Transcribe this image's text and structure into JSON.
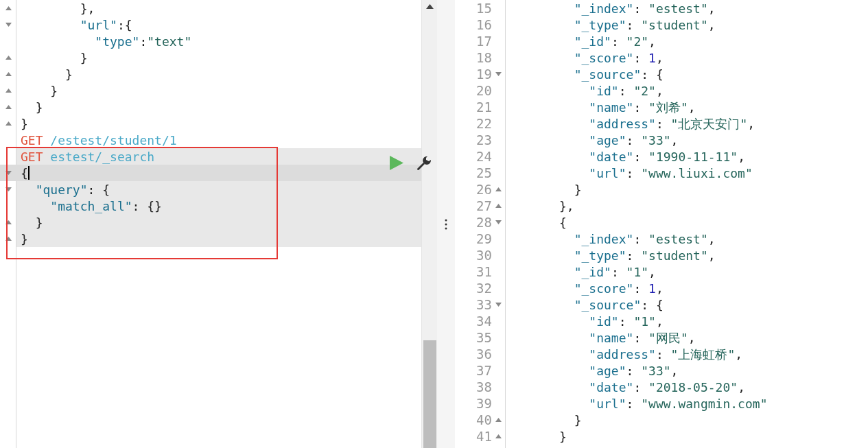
{
  "request_editor": {
    "lines": [
      {
        "kind": "close",
        "tokens": [
          {
            "kind": "punct",
            "text": "},"
          }
        ],
        "highlighted": false,
        "active": false
      },
      {
        "kind": "open",
        "tokens": [
          {
            "kind": "key",
            "text": "\"url\""
          },
          {
            "kind": "punct",
            "text": ":{"
          }
        ],
        "highlighted": false,
        "active": false
      },
      {
        "kind": "plain",
        "tokens": [
          {
            "kind": "key",
            "text": "\"type\""
          },
          {
            "kind": "punct",
            "text": ":"
          },
          {
            "kind": "str",
            "text": "\"text\""
          }
        ],
        "highlighted": false,
        "active": false
      },
      {
        "kind": "close",
        "tokens": [
          {
            "kind": "punct",
            "text": "}"
          }
        ],
        "highlighted": false,
        "active": false
      },
      {
        "kind": "close",
        "tokens": [
          {
            "kind": "punct",
            "text": "}"
          }
        ],
        "highlighted": false,
        "active": false
      },
      {
        "kind": "close",
        "tokens": [
          {
            "kind": "punct",
            "text": "}"
          }
        ],
        "highlighted": false,
        "active": false
      },
      {
        "kind": "close",
        "tokens": [
          {
            "kind": "punct",
            "text": "}"
          }
        ],
        "highlighted": false,
        "active": false
      },
      {
        "kind": "close",
        "tokens": [
          {
            "kind": "punct",
            "text": "}"
          }
        ],
        "highlighted": false,
        "active": false
      },
      {
        "kind": "plain",
        "tokens": [
          {
            "kind": "method",
            "text": "GET"
          },
          {
            "kind": "path",
            "text": "/estest/student/1"
          }
        ],
        "highlighted": false,
        "active": false
      },
      {
        "kind": "plain",
        "tokens": [
          {
            "kind": "method",
            "text": "GET"
          },
          {
            "kind": "path",
            "text": "estest/_search"
          }
        ],
        "highlighted": true,
        "active": false
      },
      {
        "kind": "open",
        "tokens": [
          {
            "kind": "punct",
            "text": "{"
          }
        ],
        "highlighted": true,
        "active": true
      },
      {
        "kind": "open",
        "tokens": [
          {
            "kind": "key",
            "text": "\"query\""
          },
          {
            "kind": "punct",
            "text": ": {"
          }
        ],
        "highlighted": true,
        "active": false
      },
      {
        "kind": "plain",
        "tokens": [
          {
            "kind": "key",
            "text": "\"match_all\""
          },
          {
            "kind": "punct",
            "text": ": {}"
          }
        ],
        "highlighted": true,
        "active": false
      },
      {
        "kind": "close",
        "tokens": [
          {
            "kind": "punct",
            "text": "}"
          }
        ],
        "highlighted": true,
        "active": false
      },
      {
        "kind": "close",
        "tokens": [
          {
            "kind": "punct",
            "text": "}"
          }
        ],
        "highlighted": true,
        "active": false
      }
    ]
  },
  "response_viewer": {
    "lines": [
      {
        "number": "15",
        "kind": "plain",
        "tokens": [
          {
            "kind": "key",
            "text": "\"_index\""
          },
          {
            "kind": "punct",
            "text": ": "
          },
          {
            "kind": "str",
            "text": "\"estest\""
          },
          {
            "kind": "punct",
            "text": ","
          }
        ]
      },
      {
        "number": "16",
        "kind": "plain",
        "tokens": [
          {
            "kind": "key",
            "text": "\"_type\""
          },
          {
            "kind": "punct",
            "text": ": "
          },
          {
            "kind": "str",
            "text": "\"student\""
          },
          {
            "kind": "punct",
            "text": ","
          }
        ]
      },
      {
        "number": "17",
        "kind": "plain",
        "tokens": [
          {
            "kind": "key",
            "text": "\"_id\""
          },
          {
            "kind": "punct",
            "text": ": "
          },
          {
            "kind": "str",
            "text": "\"2\""
          },
          {
            "kind": "punct",
            "text": ","
          }
        ]
      },
      {
        "number": "18",
        "kind": "plain",
        "tokens": [
          {
            "kind": "key",
            "text": "\"_score\""
          },
          {
            "kind": "punct",
            "text": ": "
          },
          {
            "kind": "num",
            "text": "1"
          },
          {
            "kind": "punct",
            "text": ","
          }
        ]
      },
      {
        "number": "19",
        "kind": "open",
        "tokens": [
          {
            "kind": "key",
            "text": "\"_source\""
          },
          {
            "kind": "punct",
            "text": ": {"
          }
        ]
      },
      {
        "number": "20",
        "kind": "plain",
        "tokens": [
          {
            "kind": "key",
            "text": "\"id\""
          },
          {
            "kind": "punct",
            "text": ": "
          },
          {
            "kind": "str",
            "text": "\"2\""
          },
          {
            "kind": "punct",
            "text": ","
          }
        ]
      },
      {
        "number": "21",
        "kind": "plain",
        "tokens": [
          {
            "kind": "key",
            "text": "\"name\""
          },
          {
            "kind": "punct",
            "text": ": "
          },
          {
            "kind": "str",
            "text": "\"刘希\""
          },
          {
            "kind": "punct",
            "text": ","
          }
        ]
      },
      {
        "number": "22",
        "kind": "plain",
        "tokens": [
          {
            "kind": "key",
            "text": "\"address\""
          },
          {
            "kind": "punct",
            "text": ": "
          },
          {
            "kind": "str",
            "text": "\"北京天安门\""
          },
          {
            "kind": "punct",
            "text": ","
          }
        ]
      },
      {
        "number": "23",
        "kind": "plain",
        "tokens": [
          {
            "kind": "key",
            "text": "\"age\""
          },
          {
            "kind": "punct",
            "text": ": "
          },
          {
            "kind": "str",
            "text": "\"33\""
          },
          {
            "kind": "punct",
            "text": ","
          }
        ]
      },
      {
        "number": "24",
        "kind": "plain",
        "tokens": [
          {
            "kind": "key",
            "text": "\"date\""
          },
          {
            "kind": "punct",
            "text": ": "
          },
          {
            "kind": "str",
            "text": "\"1990-11-11\""
          },
          {
            "kind": "punct",
            "text": ","
          }
        ]
      },
      {
        "number": "25",
        "kind": "plain",
        "tokens": [
          {
            "kind": "key",
            "text": "\"url\""
          },
          {
            "kind": "punct",
            "text": ": "
          },
          {
            "kind": "str",
            "text": "\"www.liuxi.com\""
          }
        ]
      },
      {
        "number": "26",
        "kind": "close",
        "tokens": [
          {
            "kind": "punct",
            "text": "}"
          }
        ]
      },
      {
        "number": "27",
        "kind": "close",
        "tokens": [
          {
            "kind": "punct",
            "text": "},"
          }
        ]
      },
      {
        "number": "28",
        "kind": "open",
        "tokens": [
          {
            "kind": "punct",
            "text": "{"
          }
        ]
      },
      {
        "number": "29",
        "kind": "plain",
        "tokens": [
          {
            "kind": "key",
            "text": "\"_index\""
          },
          {
            "kind": "punct",
            "text": ": "
          },
          {
            "kind": "str",
            "text": "\"estest\""
          },
          {
            "kind": "punct",
            "text": ","
          }
        ]
      },
      {
        "number": "30",
        "kind": "plain",
        "tokens": [
          {
            "kind": "key",
            "text": "\"_type\""
          },
          {
            "kind": "punct",
            "text": ": "
          },
          {
            "kind": "str",
            "text": "\"student\""
          },
          {
            "kind": "punct",
            "text": ","
          }
        ]
      },
      {
        "number": "31",
        "kind": "plain",
        "tokens": [
          {
            "kind": "key",
            "text": "\"_id\""
          },
          {
            "kind": "punct",
            "text": ": "
          },
          {
            "kind": "str",
            "text": "\"1\""
          },
          {
            "kind": "punct",
            "text": ","
          }
        ]
      },
      {
        "number": "32",
        "kind": "plain",
        "tokens": [
          {
            "kind": "key",
            "text": "\"_score\""
          },
          {
            "kind": "punct",
            "text": ": "
          },
          {
            "kind": "num",
            "text": "1"
          },
          {
            "kind": "punct",
            "text": ","
          }
        ]
      },
      {
        "number": "33",
        "kind": "open",
        "tokens": [
          {
            "kind": "key",
            "text": "\"_source\""
          },
          {
            "kind": "punct",
            "text": ": {"
          }
        ]
      },
      {
        "number": "34",
        "kind": "plain",
        "tokens": [
          {
            "kind": "key",
            "text": "\"id\""
          },
          {
            "kind": "punct",
            "text": ": "
          },
          {
            "kind": "str",
            "text": "\"1\""
          },
          {
            "kind": "punct",
            "text": ","
          }
        ]
      },
      {
        "number": "35",
        "kind": "plain",
        "tokens": [
          {
            "kind": "key",
            "text": "\"name\""
          },
          {
            "kind": "punct",
            "text": ": "
          },
          {
            "kind": "str",
            "text": "\"网民\""
          },
          {
            "kind": "punct",
            "text": ","
          }
        ]
      },
      {
        "number": "36",
        "kind": "plain",
        "tokens": [
          {
            "kind": "key",
            "text": "\"address\""
          },
          {
            "kind": "punct",
            "text": ": "
          },
          {
            "kind": "str",
            "text": "\"上海虹桥\""
          },
          {
            "kind": "punct",
            "text": ","
          }
        ]
      },
      {
        "number": "37",
        "kind": "plain",
        "tokens": [
          {
            "kind": "key",
            "text": "\"age\""
          },
          {
            "kind": "punct",
            "text": ": "
          },
          {
            "kind": "str",
            "text": "\"33\""
          },
          {
            "kind": "punct",
            "text": ","
          }
        ]
      },
      {
        "number": "38",
        "kind": "plain",
        "tokens": [
          {
            "kind": "key",
            "text": "\"date\""
          },
          {
            "kind": "punct",
            "text": ": "
          },
          {
            "kind": "str",
            "text": "\"2018-05-20\""
          },
          {
            "kind": "punct",
            "text": ","
          }
        ]
      },
      {
        "number": "39",
        "kind": "plain",
        "tokens": [
          {
            "kind": "key",
            "text": "\"url\""
          },
          {
            "kind": "punct",
            "text": ": "
          },
          {
            "kind": "str",
            "text": "\"www.wangmin.com\""
          }
        ]
      },
      {
        "number": "40",
        "kind": "close",
        "tokens": [
          {
            "kind": "punct",
            "text": "}"
          }
        ]
      },
      {
        "number": "41",
        "kind": "close",
        "tokens": [
          {
            "kind": "punct",
            "text": "}"
          }
        ]
      }
    ]
  }
}
